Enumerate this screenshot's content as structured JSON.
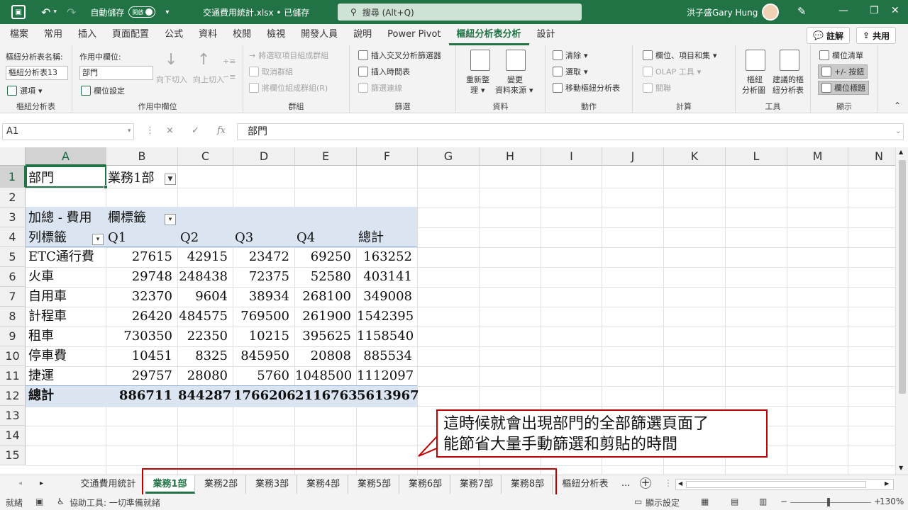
{
  "titlebar": {
    "autosave_label": "自動儲存",
    "autosave_state": "開啟",
    "filename": "交通費用統計.xlsx • 已儲存",
    "search_placeholder": "搜尋 (Alt+Q)",
    "user_name": "洪子盛Gary Hung"
  },
  "ribbon_tabs": [
    "檔案",
    "常用",
    "插入",
    "頁面配置",
    "公式",
    "資料",
    "校閱",
    "檢視",
    "開發人員",
    "說明",
    "Power Pivot",
    "樞紐分析表分析",
    "設計"
  ],
  "active_tab": "樞紐分析表分析",
  "comment_label": "註解",
  "share_label": "共用",
  "ribbon": {
    "pivot": {
      "name_label": "樞紐分析表名稱:",
      "name_value": "樞紐分析表13",
      "options_label": "選項",
      "group_label": "樞紐分析表"
    },
    "active_field": {
      "label": "作用中欄位:",
      "value": "部門",
      "settings_label": "欄位設定",
      "drill_down": "向下切入",
      "drill_up": "向上切入",
      "group_label": "作用中欄位"
    },
    "group": {
      "group_selection": "將選取項目組成群組",
      "ungroup": "取消群組",
      "group_field": "將欄位組成群組(R)",
      "group_label": "群組"
    },
    "filter": {
      "insert_slicer": "插入交叉分析篩選器",
      "insert_timeline": "插入時間表",
      "filter_connections": "篩選連線",
      "group_label": "篩選"
    },
    "data": {
      "refresh_line1": "重新整",
      "refresh_line2": "理",
      "change_source_line1": "變更",
      "change_source_line2": "資料來源",
      "group_label": "資料"
    },
    "actions": {
      "clear": "清除",
      "select": "選取",
      "move": "移動樞紐分析表",
      "group_label": "動作"
    },
    "calculations": {
      "fields_items": "欄位、項目和集",
      "olap": "OLAP 工具",
      "relationships": "關聯",
      "group_label": "計算"
    },
    "tools": {
      "pivot_chart_line1": "樞紐",
      "pivot_chart_line2": "分析圖",
      "recommended_line1": "建議的樞",
      "recommended_line2": "紐分析表",
      "group_label": "工具"
    },
    "show": {
      "field_list": "欄位清單",
      "buttons": "+/- 按鈕",
      "field_headers": "欄位標題",
      "group_label": "顯示"
    }
  },
  "formula_bar": {
    "name_box": "A1",
    "cancel": "×",
    "enter": "✓",
    "fx": "fx",
    "formula": "部門"
  },
  "columns": [
    "A",
    "B",
    "C",
    "D",
    "E",
    "F",
    "G",
    "H",
    "I",
    "J",
    "K",
    "L",
    "M",
    "N"
  ],
  "rows": [
    "1",
    "2",
    "3",
    "4",
    "5",
    "6",
    "7",
    "8",
    "9",
    "10",
    "11",
    "12",
    "13",
    "14",
    "15"
  ],
  "sheet": {
    "filter_label": "部門",
    "filter_value": "業務1部",
    "values_label": "加總 - 費用",
    "col_labels": "欄標籤",
    "row_labels": "列標籤",
    "headers": [
      "Q1",
      "Q2",
      "Q3",
      "Q4",
      "總計"
    ],
    "data": [
      {
        "label": "ETC通行費",
        "values": [
          "27615",
          "42915",
          "23472",
          "69250",
          "163252"
        ]
      },
      {
        "label": "火車",
        "values": [
          "29748",
          "248438",
          "72375",
          "52580",
          "403141"
        ]
      },
      {
        "label": "自用車",
        "values": [
          "32370",
          "9604",
          "38934",
          "268100",
          "349008"
        ]
      },
      {
        "label": "計程車",
        "values": [
          "26420",
          "484575",
          "769500",
          "261900",
          "1542395"
        ]
      },
      {
        "label": "租車",
        "values": [
          "730350",
          "22350",
          "10215",
          "395625",
          "1158540"
        ]
      },
      {
        "label": "停車費",
        "values": [
          "10451",
          "8325",
          "845950",
          "20808",
          "885534"
        ]
      },
      {
        "label": "捷運",
        "values": [
          "29757",
          "28080",
          "5760",
          "1048500",
          "1112097"
        ]
      }
    ],
    "total": {
      "label": "總計",
      "values": [
        "886711",
        "844287",
        "1766206",
        "2116763",
        "5613967"
      ]
    }
  },
  "callout": {
    "line1": "這時候就會出現部門的全部篩選頁面了",
    "line2": "能節省大量手動篩選和剪貼的時間"
  },
  "sheet_tabs": [
    "交通費用統計",
    "業務1部",
    "業務2部",
    "業務3部",
    "業務4部",
    "業務5部",
    "業務6部",
    "業務7部",
    "業務8部",
    "樞紐分析表"
  ],
  "active_sheet": "業務1部",
  "statusbar": {
    "ready": "就緒",
    "accessibility": "協助工具: 一切準備就緒",
    "display_settings": "顯示設定",
    "zoom": "130%"
  },
  "colors": {
    "excel_green": "#217346",
    "pivot_band": "#dbe5f1",
    "callout_red": "#c00000"
  }
}
